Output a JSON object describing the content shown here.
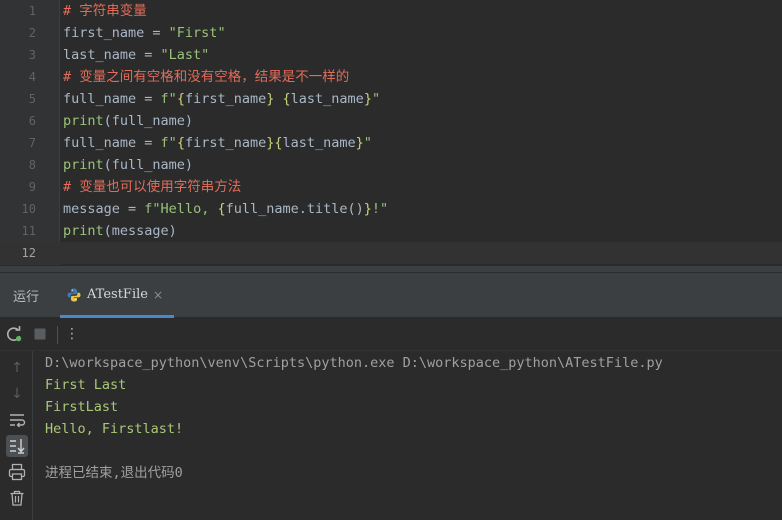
{
  "editor": {
    "lines": [
      {
        "num": "1",
        "tokens": [
          {
            "t": "# 字符串变量",
            "c": "comment"
          }
        ]
      },
      {
        "num": "2",
        "tokens": [
          {
            "t": "first_name",
            "c": "var"
          },
          {
            "t": " = ",
            "c": "op"
          },
          {
            "t": "\"First\"",
            "c": "strbright"
          }
        ]
      },
      {
        "num": "3",
        "tokens": [
          {
            "t": "last_name",
            "c": "var"
          },
          {
            "t": " = ",
            "c": "op"
          },
          {
            "t": "\"Last\"",
            "c": "strbright"
          }
        ]
      },
      {
        "num": "4",
        "tokens": [
          {
            "t": "# 变量之间有空格和没有空格，结果是不一样的",
            "c": "comment"
          }
        ]
      },
      {
        "num": "5",
        "tokens": [
          {
            "t": "full_name",
            "c": "var"
          },
          {
            "t": " = ",
            "c": "op"
          },
          {
            "t": "f\"",
            "c": "strbright"
          },
          {
            "t": "{",
            "c": "brace"
          },
          {
            "t": "first_name",
            "c": "var"
          },
          {
            "t": "}",
            "c": "brace"
          },
          {
            "t": " ",
            "c": "strbright"
          },
          {
            "t": "{",
            "c": "brace"
          },
          {
            "t": "last_name",
            "c": "var"
          },
          {
            "t": "}",
            "c": "brace"
          },
          {
            "t": "\"",
            "c": "strbright"
          }
        ]
      },
      {
        "num": "6",
        "tokens": [
          {
            "t": "print",
            "c": "fn"
          },
          {
            "t": "(full_name)",
            "c": "var"
          }
        ]
      },
      {
        "num": "7",
        "tokens": [
          {
            "t": "full_name",
            "c": "var"
          },
          {
            "t": " = ",
            "c": "op"
          },
          {
            "t": "f\"",
            "c": "strbright"
          },
          {
            "t": "{",
            "c": "brace"
          },
          {
            "t": "first_name",
            "c": "var"
          },
          {
            "t": "}{",
            "c": "brace"
          },
          {
            "t": "last_name",
            "c": "var"
          },
          {
            "t": "}",
            "c": "brace"
          },
          {
            "t": "\"",
            "c": "strbright"
          }
        ]
      },
      {
        "num": "8",
        "tokens": [
          {
            "t": "print",
            "c": "fn"
          },
          {
            "t": "(full_name)",
            "c": "var"
          }
        ]
      },
      {
        "num": "9",
        "tokens": [
          {
            "t": "# 变量也可以使用字符串方法",
            "c": "comment"
          }
        ]
      },
      {
        "num": "10",
        "tokens": [
          {
            "t": "message",
            "c": "var"
          },
          {
            "t": " = ",
            "c": "op"
          },
          {
            "t": "f\"Hello, ",
            "c": "strbright"
          },
          {
            "t": "{",
            "c": "brace"
          },
          {
            "t": "full_name.title()",
            "c": "var"
          },
          {
            "t": "}",
            "c": "brace"
          },
          {
            "t": "!\"",
            "c": "strbright"
          }
        ]
      },
      {
        "num": "11",
        "tokens": [
          {
            "t": "print",
            "c": "fn"
          },
          {
            "t": "(message)",
            "c": "var"
          }
        ]
      },
      {
        "num": "12",
        "tokens": []
      }
    ]
  },
  "run_panel": {
    "tab_run_label": "运行",
    "tab_file_label": "ATestFile",
    "tab_close_glyph": "×",
    "toolbar": {
      "rerun_icon": "↻",
      "stop_icon": "■",
      "more_icon": "⋮"
    },
    "sidebar": {
      "up_icon": "↑",
      "down_icon": "↓",
      "softwrap_icon": "⇉",
      "scroll_end_icon": "⇊",
      "print_icon": "⎙",
      "trash_icon": "🗑"
    },
    "console": {
      "command": "D:\\workspace_python\\venv\\Scripts\\python.exe D:\\workspace_python\\ATestFile.py",
      "outputs": [
        "First Last",
        "FirstLast",
        "Hello, Firstlast!"
      ],
      "exit_message": "进程已结束,退出代码0"
    }
  }
}
